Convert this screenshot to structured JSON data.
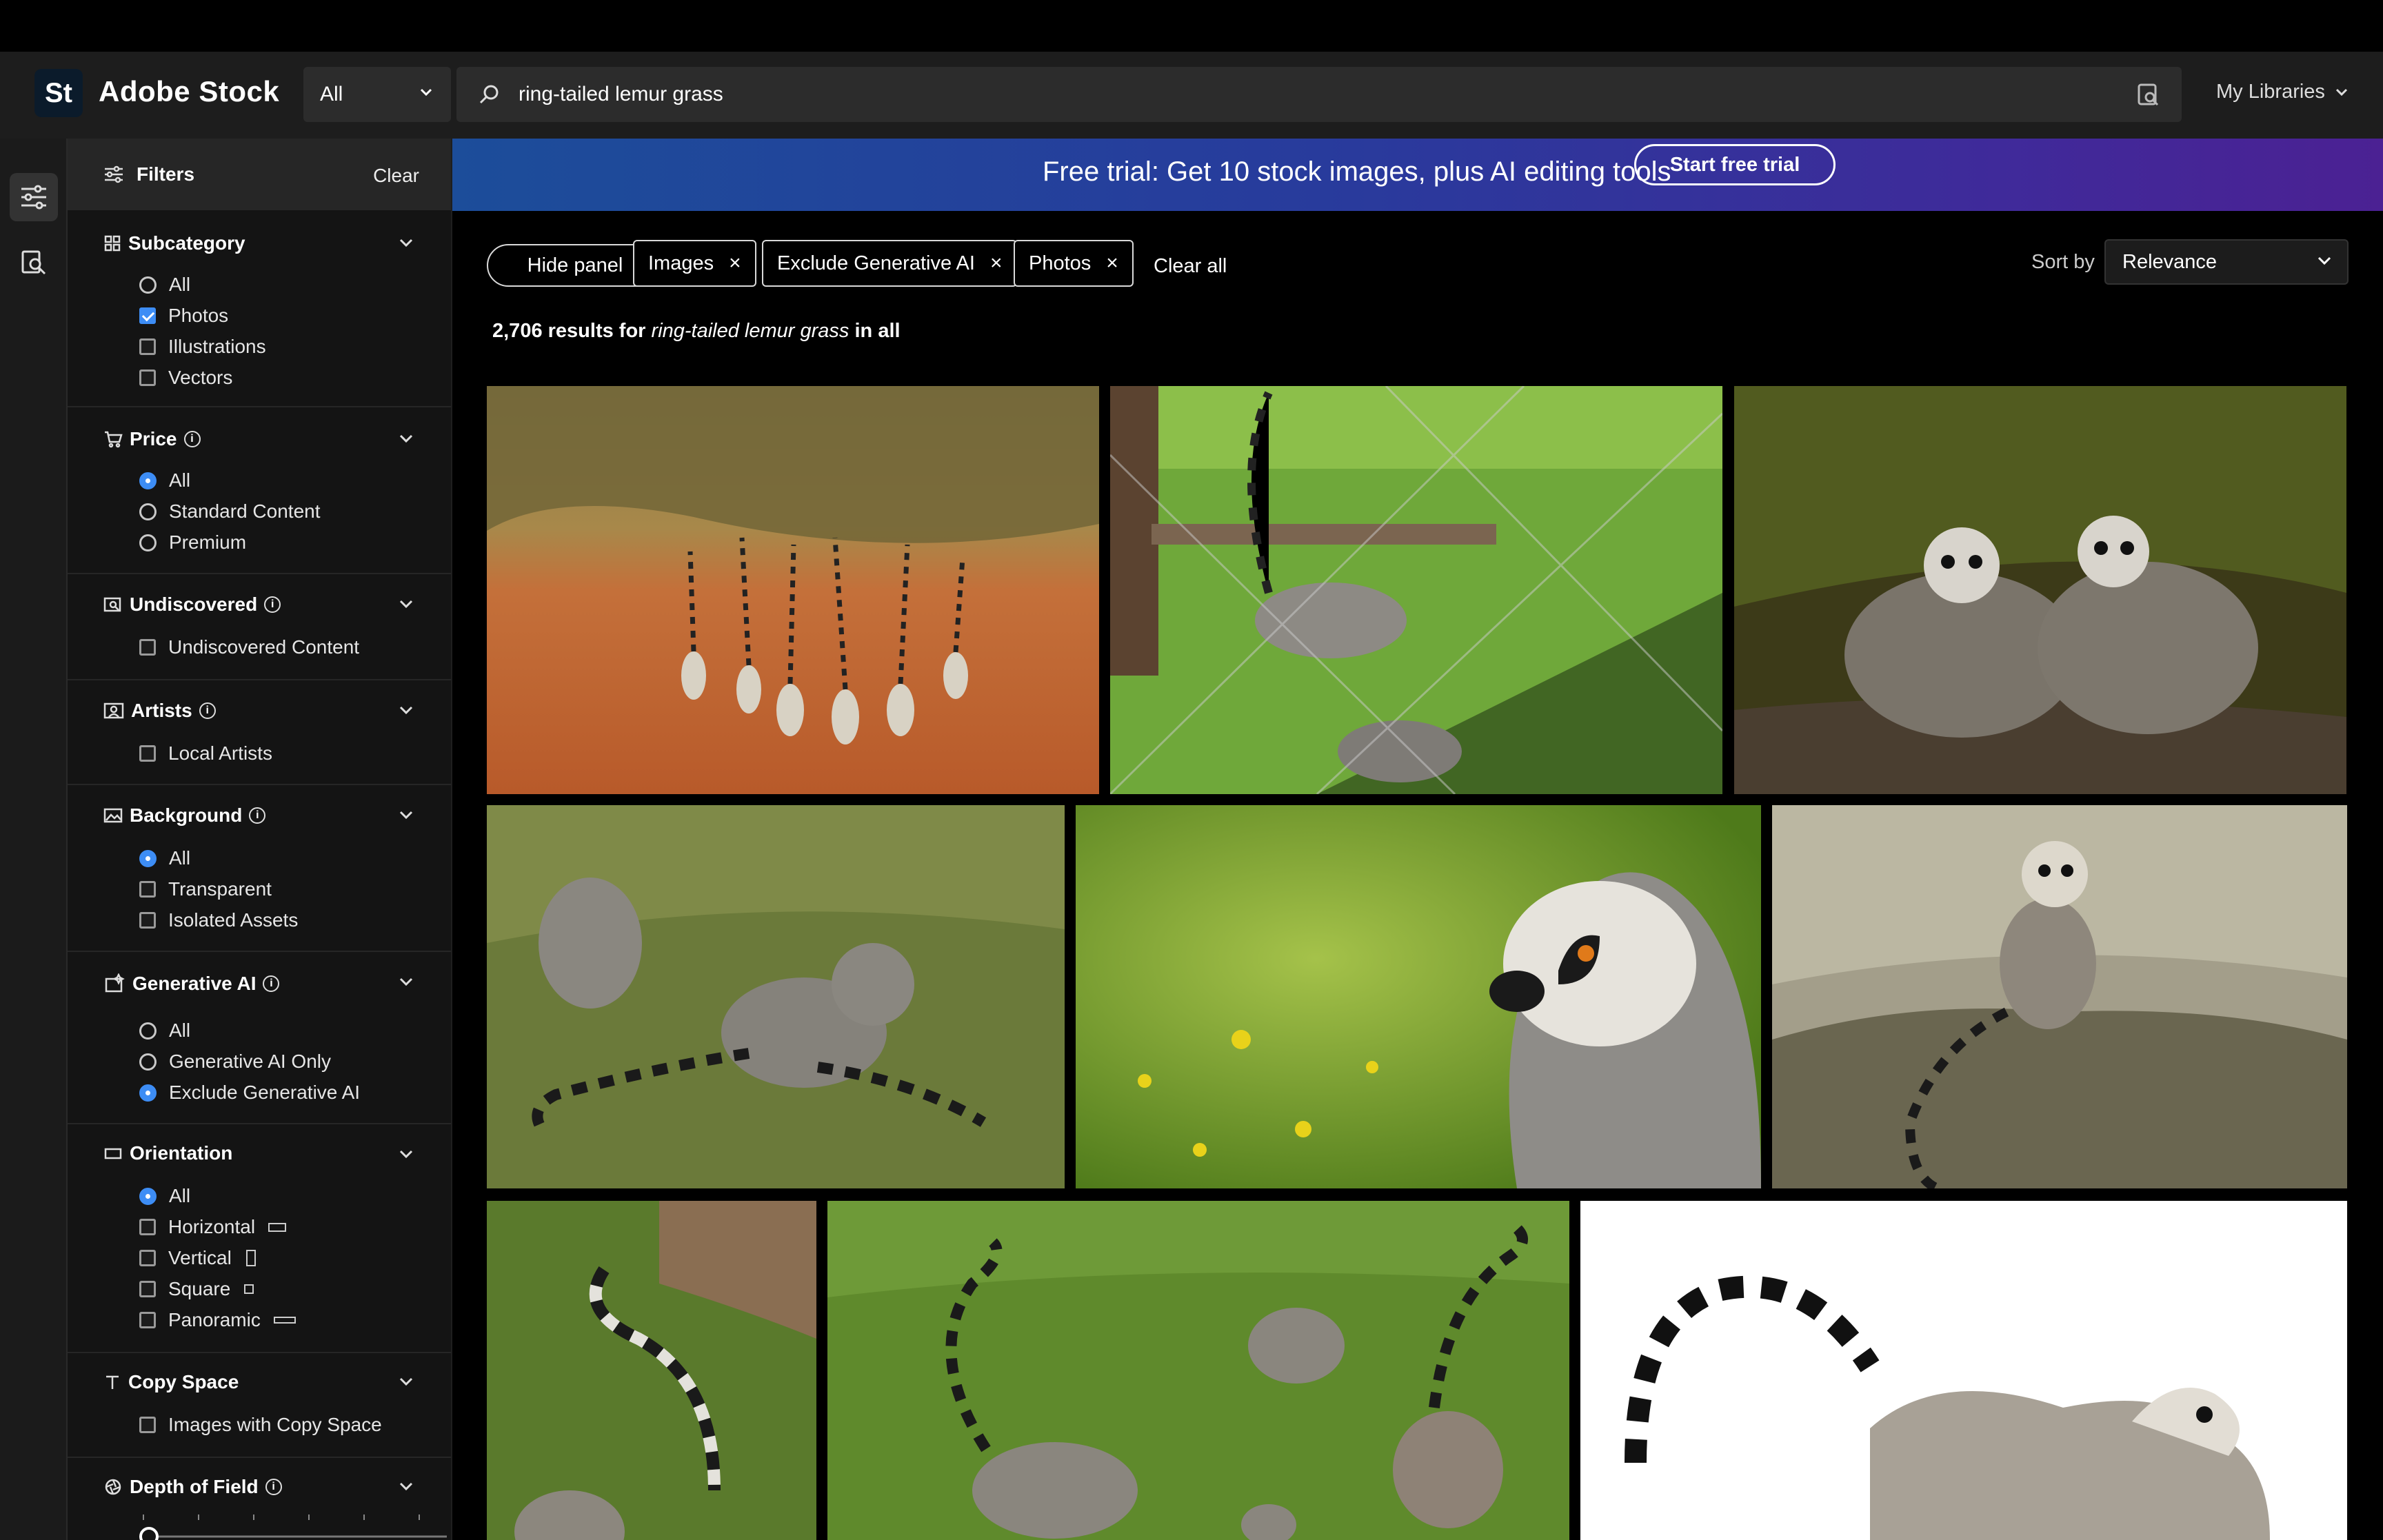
{
  "header": {
    "logo_text": "St",
    "brand": "Adobe Stock",
    "scope": "All",
    "search_value": "ring-tailed lemur grass",
    "my_libraries": "My Libraries"
  },
  "filters": {
    "title": "Filters",
    "clear": "Clear",
    "sections": {
      "subcategory": {
        "title": "Subcategory",
        "options": [
          "All",
          "Photos",
          "Illustrations",
          "Vectors"
        ]
      },
      "price": {
        "title": "Price",
        "options": [
          "All",
          "Standard Content",
          "Premium"
        ]
      },
      "undiscovered": {
        "title": "Undiscovered",
        "options": [
          "Undiscovered Content"
        ]
      },
      "artists": {
        "title": "Artists",
        "options": [
          "Local Artists"
        ]
      },
      "background": {
        "title": "Background",
        "options": [
          "All",
          "Transparent",
          "Isolated Assets"
        ]
      },
      "generative_ai": {
        "title": "Generative AI",
        "options": [
          "All",
          "Generative AI Only",
          "Exclude Generative AI"
        ]
      },
      "orientation": {
        "title": "Orientation",
        "options": [
          "All",
          "Horizontal",
          "Vertical",
          "Square",
          "Panoramic"
        ]
      },
      "copy_space": {
        "title": "Copy Space",
        "options": [
          "Images with Copy Space"
        ]
      },
      "depth_of_field": {
        "title": "Depth of Field"
      }
    }
  },
  "banner": {
    "text": "Free trial: Get 10 stock images, plus AI editing tools",
    "cta": "Start free trial"
  },
  "toolbar": {
    "hide_panel": "Hide panel",
    "chips": [
      "Images",
      "Exclude Generative AI",
      "Photos"
    ],
    "clear_all": "Clear all",
    "sort_label": "Sort by",
    "sort_value": "Relevance"
  },
  "results": {
    "count": "2,706",
    "for": "results for",
    "query": "ring-tailed lemur grass",
    "in": "in all"
  },
  "colors": {
    "accent": "#3d8df5",
    "banner_start": "#1c4d9a",
    "banner_end": "#4b2193"
  }
}
